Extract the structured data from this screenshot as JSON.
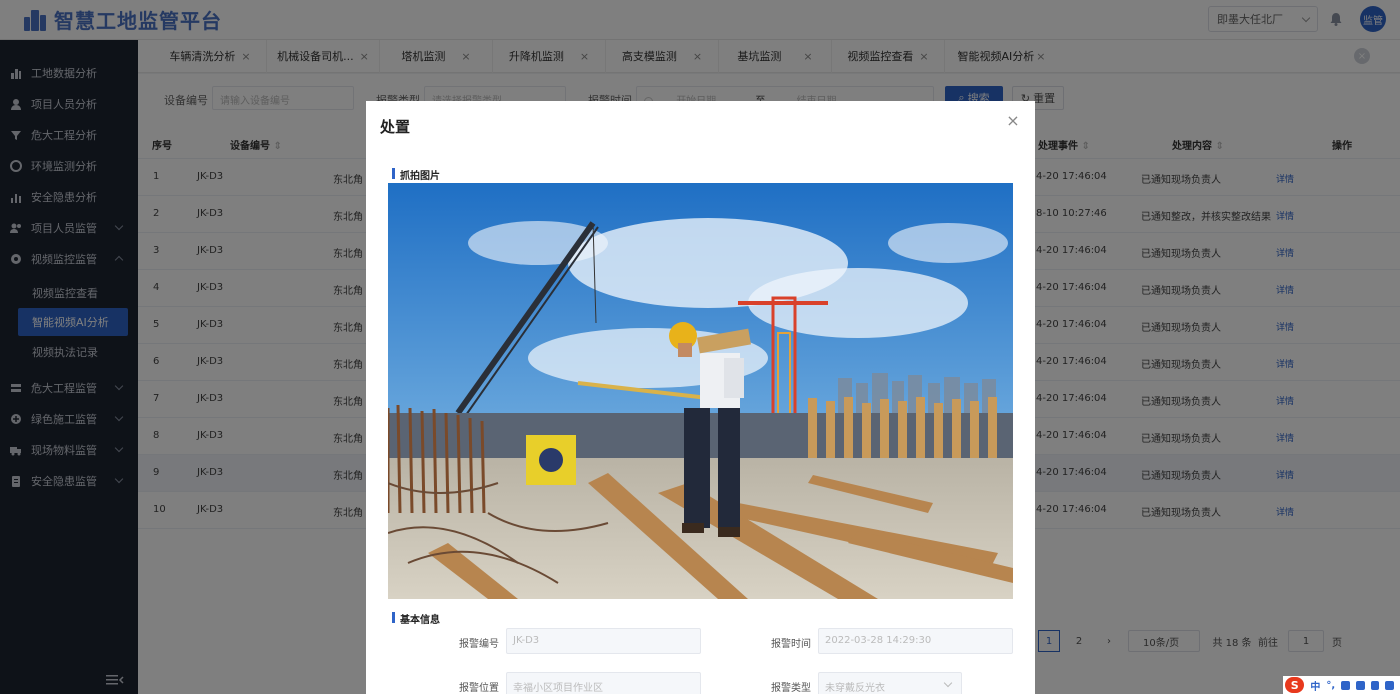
{
  "app": {
    "title": "智慧工地监管平台"
  },
  "header": {
    "project_select": "即墨大任北厂",
    "avatar_label": "监管"
  },
  "sidebar": {
    "items": [
      {
        "label": "工地数据分析"
      },
      {
        "label": "项目人员分析"
      },
      {
        "label": "危大工程分析"
      },
      {
        "label": "环境监测分析"
      },
      {
        "label": "安全隐患分析"
      },
      {
        "label": "项目人员监管"
      },
      {
        "label": "视频监控监管"
      },
      {
        "label": "危大工程监管"
      },
      {
        "label": "绿色施工监管"
      },
      {
        "label": "现场物料监管"
      },
      {
        "label": "安全隐患监管"
      }
    ],
    "sub_items": [
      {
        "label": "视频监控查看"
      },
      {
        "label": "智能视频AI分析"
      },
      {
        "label": "视频执法记录"
      }
    ]
  },
  "tabs": [
    {
      "label": "车辆清洗分析"
    },
    {
      "label": "机械设备司机..."
    },
    {
      "label": "塔机监测"
    },
    {
      "label": "升降机监测"
    },
    {
      "label": "高支模监测"
    },
    {
      "label": "基坑监测"
    },
    {
      "label": "视频监控查看"
    },
    {
      "label": "智能视频AI分析"
    }
  ],
  "filters": {
    "device_label": "设备编号",
    "device_placeholder": "请输入设备编号",
    "type_label": "报警类型",
    "type_placeholder": "请选择报警类型",
    "time_label": "报警时间",
    "start_placeholder": "开始日期",
    "range_sep": "至",
    "end_placeholder": "结束日期",
    "search_button": "搜索",
    "reset_button": "重置"
  },
  "table": {
    "headers": {
      "index": "序号",
      "device": "设备编号",
      "event": "处理事件",
      "content": "处理内容",
      "action": "操作"
    },
    "rows": [
      {
        "index": "1",
        "device": "JK-D3",
        "location": "东北角",
        "time": "4-20 17:46:04",
        "content": "已通知现场负责人",
        "action": "详情"
      },
      {
        "index": "2",
        "device": "JK-D3",
        "location": "东北角",
        "time": "8-10 10:27:46",
        "content": "已通知整改，并核实整改结果",
        "action": "详情"
      },
      {
        "index": "3",
        "device": "JK-D3",
        "location": "东北角",
        "time": "4-20 17:46:04",
        "content": "已通知现场负责人",
        "action": "详情"
      },
      {
        "index": "4",
        "device": "JK-D3",
        "location": "东北角",
        "time": "4-20 17:46:04",
        "content": "已通知现场负责人",
        "action": "详情"
      },
      {
        "index": "5",
        "device": "JK-D3",
        "location": "东北角",
        "time": "4-20 17:46:04",
        "content": "已通知现场负责人",
        "action": "详情"
      },
      {
        "index": "6",
        "device": "JK-D3",
        "location": "东北角",
        "time": "4-20 17:46:04",
        "content": "已通知现场负责人",
        "action": "详情"
      },
      {
        "index": "7",
        "device": "JK-D3",
        "location": "东北角",
        "time": "4-20 17:46:04",
        "content": "已通知现场负责人",
        "action": "详情"
      },
      {
        "index": "8",
        "device": "JK-D3",
        "location": "东北角",
        "time": "4-20 17:46:04",
        "content": "已通知现场负责人",
        "action": "详情"
      },
      {
        "index": "9",
        "device": "JK-D3",
        "location": "东北角",
        "time": "4-20 17:46:04",
        "content": "已通知现场负责人",
        "action": "详情"
      },
      {
        "index": "10",
        "device": "JK-D3",
        "location": "东北角",
        "time": "4-20 17:46:04",
        "content": "已通知现场负责人",
        "action": "详情"
      }
    ]
  },
  "pagination": {
    "page1": "1",
    "page2": "2",
    "next": "›",
    "page_size": "10条/页",
    "total": "共 18 条",
    "goto_label": "前往",
    "goto_value": "1",
    "goto_unit": "页"
  },
  "dialog": {
    "title": "处置",
    "close": "×",
    "photo_section": "抓拍图片",
    "info_section": "基本信息",
    "fields": {
      "alarm_no_label": "报警编号",
      "alarm_no_value": "JK-D3",
      "alarm_time_label": "报警时间",
      "alarm_time_value": "2022-03-28 14:29:30",
      "alarm_loc_label": "报警位置",
      "alarm_loc_value": "幸福小区项目作业区",
      "alarm_type_label": "报警类型",
      "alarm_type_value": "未穿戴反光衣"
    }
  },
  "tray": {
    "ime_logo": "S",
    "ime_lang": "中",
    "ime_punct": "°,"
  },
  "colors": {
    "primary": "#2f64c8",
    "sidebar_bg": "#1d2431",
    "sky": "#3b84d0"
  }
}
